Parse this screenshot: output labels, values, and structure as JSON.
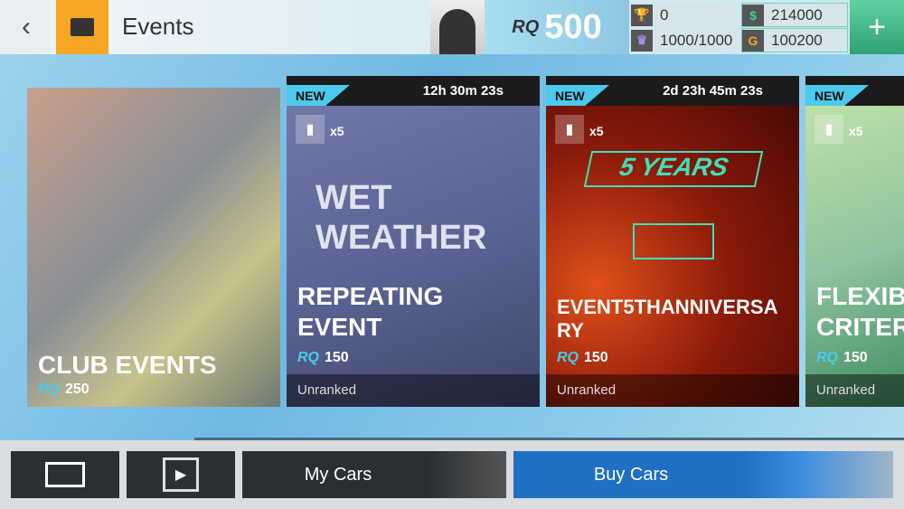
{
  "header": {
    "title": "Events",
    "rq_value": "500",
    "rq_label": "RQ",
    "trophies": "0",
    "crowns": "1000/1000",
    "cash": "214000",
    "gold": "100200"
  },
  "events": [
    {
      "name": "CLUB EVENTS",
      "rq": "250"
    },
    {
      "tag": "NEW",
      "timer": "12h 30m 23s",
      "tickets": "x5",
      "art": "WET WEATHER",
      "name": "REPEATING EVENT",
      "rq": "150",
      "status": "Unranked"
    },
    {
      "tag": "NEW",
      "timer": "2d 23h 45m 23s",
      "tickets": "x5",
      "art": "5 YEARS",
      "name": "EVENT5THANNIVERSARY",
      "rq": "150",
      "status": "Unranked"
    },
    {
      "tag": "NEW",
      "tickets": "x5",
      "name": "FLEXIB CRITER",
      "rq": "150",
      "status": "Unranked"
    }
  ],
  "bottom": {
    "my_cars": "My Cars",
    "buy_cars": "Buy Cars"
  },
  "colors": {
    "accent": "#4cc9ec",
    "events_icon": "#f5a623",
    "plus": "#2ea274",
    "buy": "#1f6fc4"
  }
}
